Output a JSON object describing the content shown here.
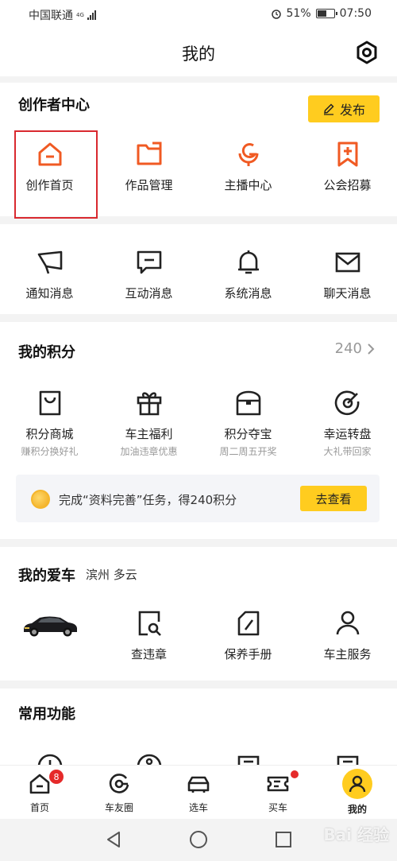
{
  "status": {
    "carrier": "中国联通",
    "network": "4G",
    "battery_pct": 0.51,
    "battery": "51%",
    "time": "07:50"
  },
  "header": {
    "title": "我的",
    "settings_icon": "gear-icon"
  },
  "creator": {
    "title": "创作者中心",
    "publish_label": "发布",
    "items": [
      {
        "label": "创作首页",
        "icon": "home-icon"
      },
      {
        "label": "作品管理",
        "icon": "folder-icon"
      },
      {
        "label": "主播中心",
        "icon": "microphone-icon"
      },
      {
        "label": "公会招募",
        "icon": "bookmark-plus-icon"
      }
    ]
  },
  "messages": {
    "items": [
      {
        "label": "通知消息",
        "icon": "megaphone-icon"
      },
      {
        "label": "互动消息",
        "icon": "chat-icon"
      },
      {
        "label": "系统消息",
        "icon": "bell-icon"
      },
      {
        "label": "聊天消息",
        "icon": "mail-icon"
      }
    ]
  },
  "points": {
    "title": "我的积分",
    "value": "240",
    "items": [
      {
        "label": "积分商城",
        "sub": "赚积分换好礼",
        "icon": "shopping-bag-icon"
      },
      {
        "label": "车主福利",
        "sub": "加油违章优惠",
        "icon": "gift-icon"
      },
      {
        "label": "积分夺宝",
        "sub": "周二周五开奖",
        "icon": "treasure-box-icon"
      },
      {
        "label": "幸运转盘",
        "sub": "大礼带回家",
        "icon": "target-icon"
      }
    ],
    "task_text": "完成“资料完善”任务，得240积分",
    "task_button": "去查看"
  },
  "car": {
    "title": "我的爱车",
    "location": "滨州  多云",
    "items": [
      {
        "label": "查违章",
        "icon": "search-doc-icon"
      },
      {
        "label": "保养手册",
        "icon": "manual-icon"
      },
      {
        "label": "车主服务",
        "icon": "user-icon"
      }
    ]
  },
  "common": {
    "title": "常用功能"
  },
  "tabbar": {
    "items": [
      {
        "label": "首页",
        "icon": "home-icon",
        "badge": "8"
      },
      {
        "label": "车友圈",
        "icon": "circle-icon"
      },
      {
        "label": "选车",
        "icon": "car-icon"
      },
      {
        "label": "买车",
        "icon": "ticket-icon"
      },
      {
        "label": "我的",
        "icon": "person-icon"
      }
    ]
  },
  "watermark": "Bai 经验"
}
